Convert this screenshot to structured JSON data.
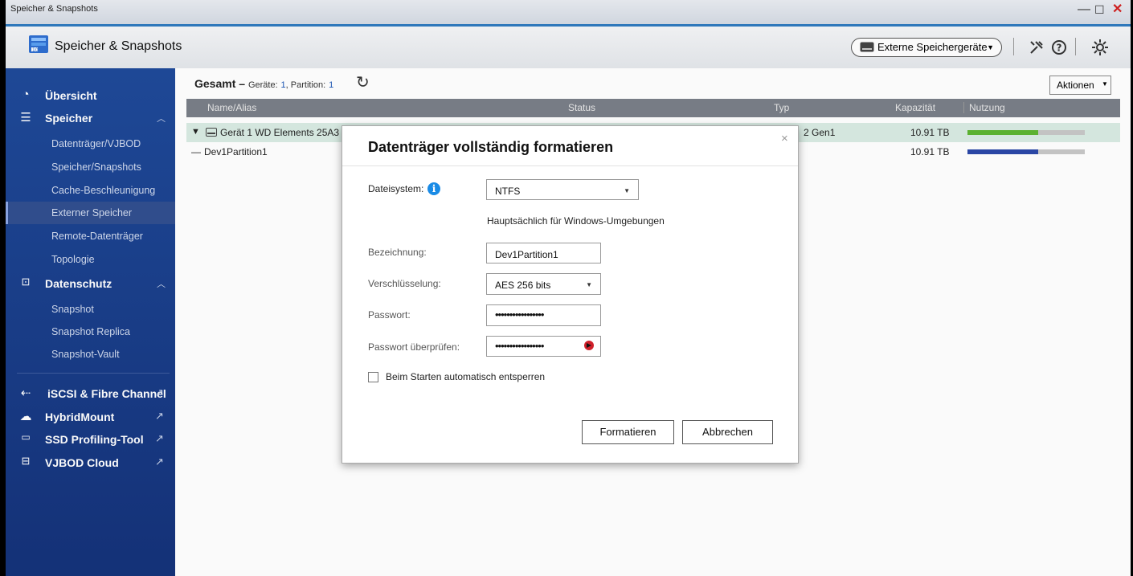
{
  "window": {
    "title": "Speicher & Snapshots",
    "controls": {
      "minimize": "—",
      "maximize": "☐",
      "close": "✕"
    }
  },
  "app": {
    "title": "Speicher & Snapshots",
    "external_devices_label": "Externe Speichergeräte"
  },
  "sidebar": {
    "items": [
      {
        "label": "Übersicht",
        "icon": "speedometer-icon",
        "type": "head"
      },
      {
        "label": "Speicher",
        "icon": "database-icon",
        "type": "head",
        "chevron": "^"
      },
      {
        "label": "Datenträger/VJBOD",
        "type": "sub"
      },
      {
        "label": "Speicher/Snapshots",
        "type": "sub"
      },
      {
        "label": "Cache-Beschleunigung",
        "type": "sub"
      },
      {
        "label": "Externer Speicher",
        "type": "sub",
        "active": true
      },
      {
        "label": "Remote-Datenträger",
        "type": "sub"
      },
      {
        "label": "Topologie",
        "type": "sub"
      },
      {
        "label": "Datenschutz",
        "icon": "protection-icon",
        "type": "head",
        "chevron": "^"
      },
      {
        "label": "Snapshot",
        "type": "sub"
      },
      {
        "label": "Snapshot Replica",
        "type": "sub"
      },
      {
        "label": "Snapshot-Vault",
        "type": "sub"
      },
      {
        "label": "iSCSI & Fibre Channel",
        "icon": "iscsi-icon",
        "type": "head",
        "external": true
      },
      {
        "label": "HybridMount",
        "icon": "cloud-link-icon",
        "type": "head",
        "external": true
      },
      {
        "label": "SSD Profiling-Tool",
        "icon": "ssd-icon",
        "type": "head",
        "external": true
      },
      {
        "label": "VJBOD Cloud",
        "icon": "vjbod-cloud-icon",
        "type": "head",
        "external": true
      }
    ]
  },
  "main": {
    "summary": {
      "title": "Gesamt",
      "dash": "–",
      "devices_label": "Geräte:",
      "devices_count": "1",
      "partition_label": "Partition:",
      "partition_count": "1"
    },
    "actions_label": "Aktionen",
    "columns": [
      "Name/Alias",
      "Status",
      "Typ",
      "Kapazität",
      "Nutzung"
    ],
    "rows": [
      {
        "name": "Gerät 1 WD Elements 25A3",
        "type": "2 Gen1",
        "capacity": "10.91 TB",
        "usage": 0.6,
        "usage_color": "#5db532"
      },
      {
        "name": "Dev1Partition1",
        "type": "",
        "capacity": "10.91 TB",
        "usage": 0.6,
        "usage_color": "#2b48a8"
      }
    ]
  },
  "dialog": {
    "title": "Datenträger vollständig formatieren",
    "close": "×",
    "filesystem_label": "Dateisystem:",
    "filesystem_value": "NTFS",
    "filesystem_hint": "Hauptsächlich für Windows-Umgebungen",
    "label_label": "Bezeichnung:",
    "label_value": "Dev1Partition1",
    "encryption_label": "Verschlüsselung:",
    "encryption_value": "AES 256 bits",
    "password_label": "Passwort:",
    "password_value": "•••••••••••••••••",
    "password_verify_label": "Passwort überprüfen:",
    "password_verify_value": "•••••••••••••••••",
    "auto_unlock_label": "Beim Starten automatisch entsperren",
    "auto_unlock_checked": false,
    "format_button": "Formatieren",
    "cancel_button": "Abbrechen"
  }
}
